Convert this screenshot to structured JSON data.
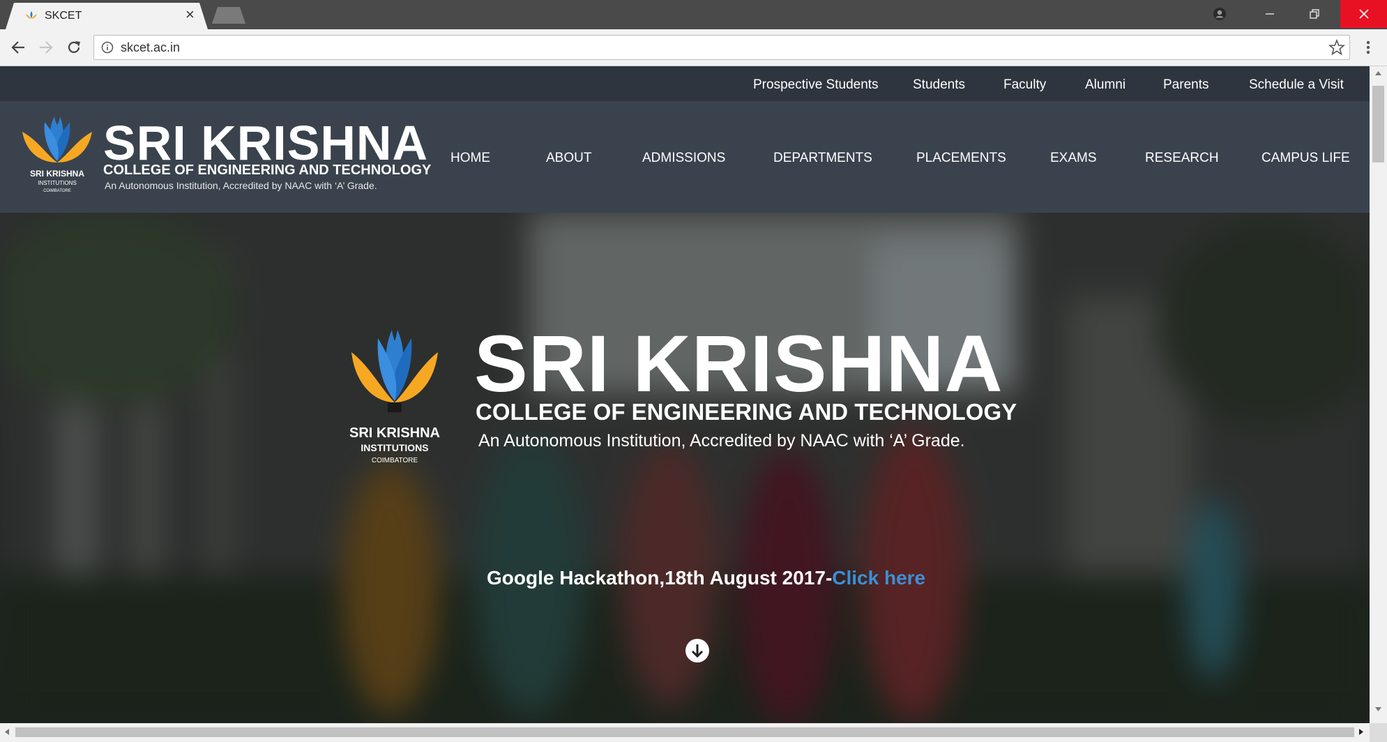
{
  "browser": {
    "tab_title": "SKCET",
    "url": "skcet.ac.in"
  },
  "topbar": {
    "links": [
      "Prospective Students",
      "Students",
      "Faculty",
      "Alumni",
      "Parents",
      "Schedule a Visit"
    ]
  },
  "brand": {
    "name": "SRI KRISHNA",
    "subtitle": "COLLEGE OF ENGINEERING AND TECHNOLOGY",
    "tagline": "An Autonomous Institution, Accredited by NAAC with ‘A’ Grade.",
    "logo_text_1": "SRI KRISHNA",
    "logo_text_2": "INSTITUTIONS",
    "logo_text_3": "COIMBATORE"
  },
  "mainnav": {
    "items": [
      "HOME",
      "ABOUT",
      "ADMISSIONS",
      "DEPARTMENTS",
      "PLACEMENTS",
      "EXAMS",
      "RESEARCH",
      "CAMPUS LIFE"
    ]
  },
  "hero": {
    "title": "SRI KRISHNA",
    "subtitle": "COLLEGE OF ENGINEERING AND TECHNOLOGY",
    "tagline": "An Autonomous Institution, Accredited by NAAC with ‘A’ Grade.",
    "announcement_text": "Google Hackathon,18th August 2017-",
    "announcement_link": "Click here"
  },
  "colors": {
    "topbar": "#2e353e",
    "nav": "#3a434d",
    "link_accent": "#3c8fd6",
    "close_button": "#e81123",
    "logo_blue": "#2f7fd1",
    "logo_orange": "#f7a823"
  },
  "icons": [
    "skcet-favicon-icon",
    "tab-close-icon",
    "profile-icon",
    "minimize-icon",
    "maximize-icon",
    "window-close-icon",
    "back-arrow-icon",
    "forward-arrow-icon",
    "reload-icon",
    "info-icon",
    "bookmark-star-icon",
    "menu-dots-icon",
    "scroll-down-arrow-icon"
  ]
}
